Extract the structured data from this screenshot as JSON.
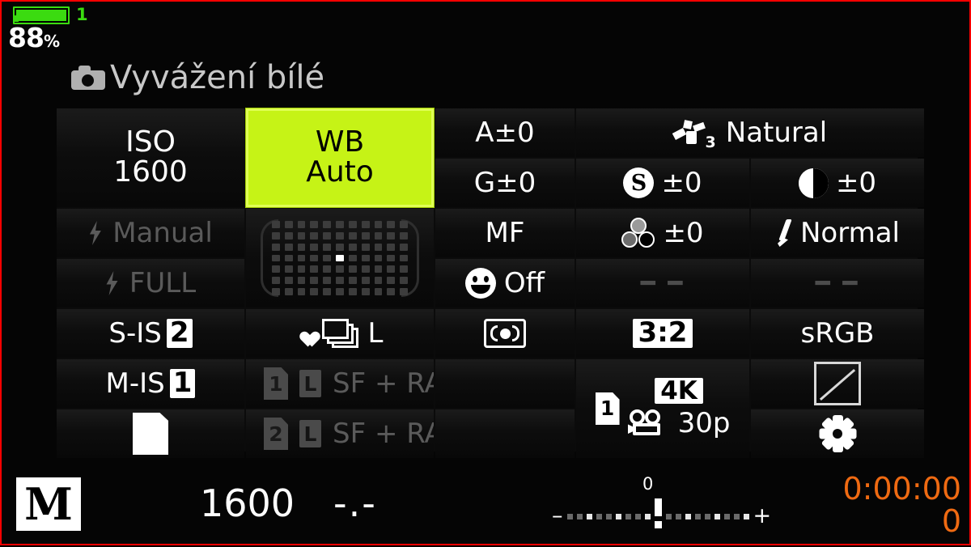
{
  "status_bar": {
    "battery_icon": "battery-icon",
    "battery_slot": "1",
    "battery_percent": "88",
    "battery_percent_unit": "%",
    "battery_color": "#3bdb10"
  },
  "header": {
    "camera_icon": "camera-icon",
    "title": "Vyvážení bílé"
  },
  "panel": {
    "selected_cell": "wb",
    "highlight_color": "#c6f316",
    "iso_label": "ISO",
    "iso_value": "1600",
    "wb_label": "WB",
    "wb_value": "Auto",
    "wb_amber": "A±0",
    "wb_green": "G±0",
    "picture_mode_icon": "picture-mode-icon",
    "picture_mode_index": "3",
    "picture_mode": "Natural",
    "saturation_icon": "saturation-icon",
    "saturation": "±0",
    "contrast_icon": "contrast-icon",
    "contrast": "±0",
    "flash_mode": "Manual",
    "flash_power": "FULL",
    "af_area_icon": "af-area-grid",
    "af_columns": 11,
    "af_rows": 7,
    "af_selected_index": 38,
    "focus_mode": "MF",
    "face_detect_icon": "face-detect-icon",
    "face_detect": "Off",
    "sharpness_icon": "sharpness-icon",
    "sharpness": "±0",
    "gradation_icon": "brush-icon",
    "gradation": "Normal",
    "dash_1": "━ ━",
    "dash_2": "━ ━",
    "is_still": "S-IS",
    "is_still_num": "2",
    "is_movie": "M-IS",
    "is_movie_num": "1",
    "sheet_icon": "sheet-icon",
    "drive_heart_icon": "heart-icon",
    "drive_frames_icon": "sequential-frames-icon",
    "drive_mode": "L",
    "card1_num": "1",
    "card1_size": "L",
    "card1_quality": "SF + RAW",
    "card2_num": "2",
    "card2_size": "L",
    "card2_quality": "SF + RAW",
    "metering_icon": "esp-metering-icon",
    "aspect_ratio": "3:2",
    "movie_card": "1",
    "movie_resolution": "4K",
    "movie_icon": "movie-camera-icon",
    "movie_framerate": "30p",
    "color_space": "sRGB",
    "highlight_shadow_icon": "highlight-shadow-icon",
    "custom_icon": "gear-icon"
  },
  "bottom_bar": {
    "shooting_mode": "M",
    "shutter_value": "1600",
    "aperture_value": "-.-",
    "exposure_zero": "0",
    "exposure_minus": "–",
    "exposure_plus": "+",
    "record_time": "0:00:00",
    "record_count": "0",
    "record_color": "#ef6a12"
  }
}
